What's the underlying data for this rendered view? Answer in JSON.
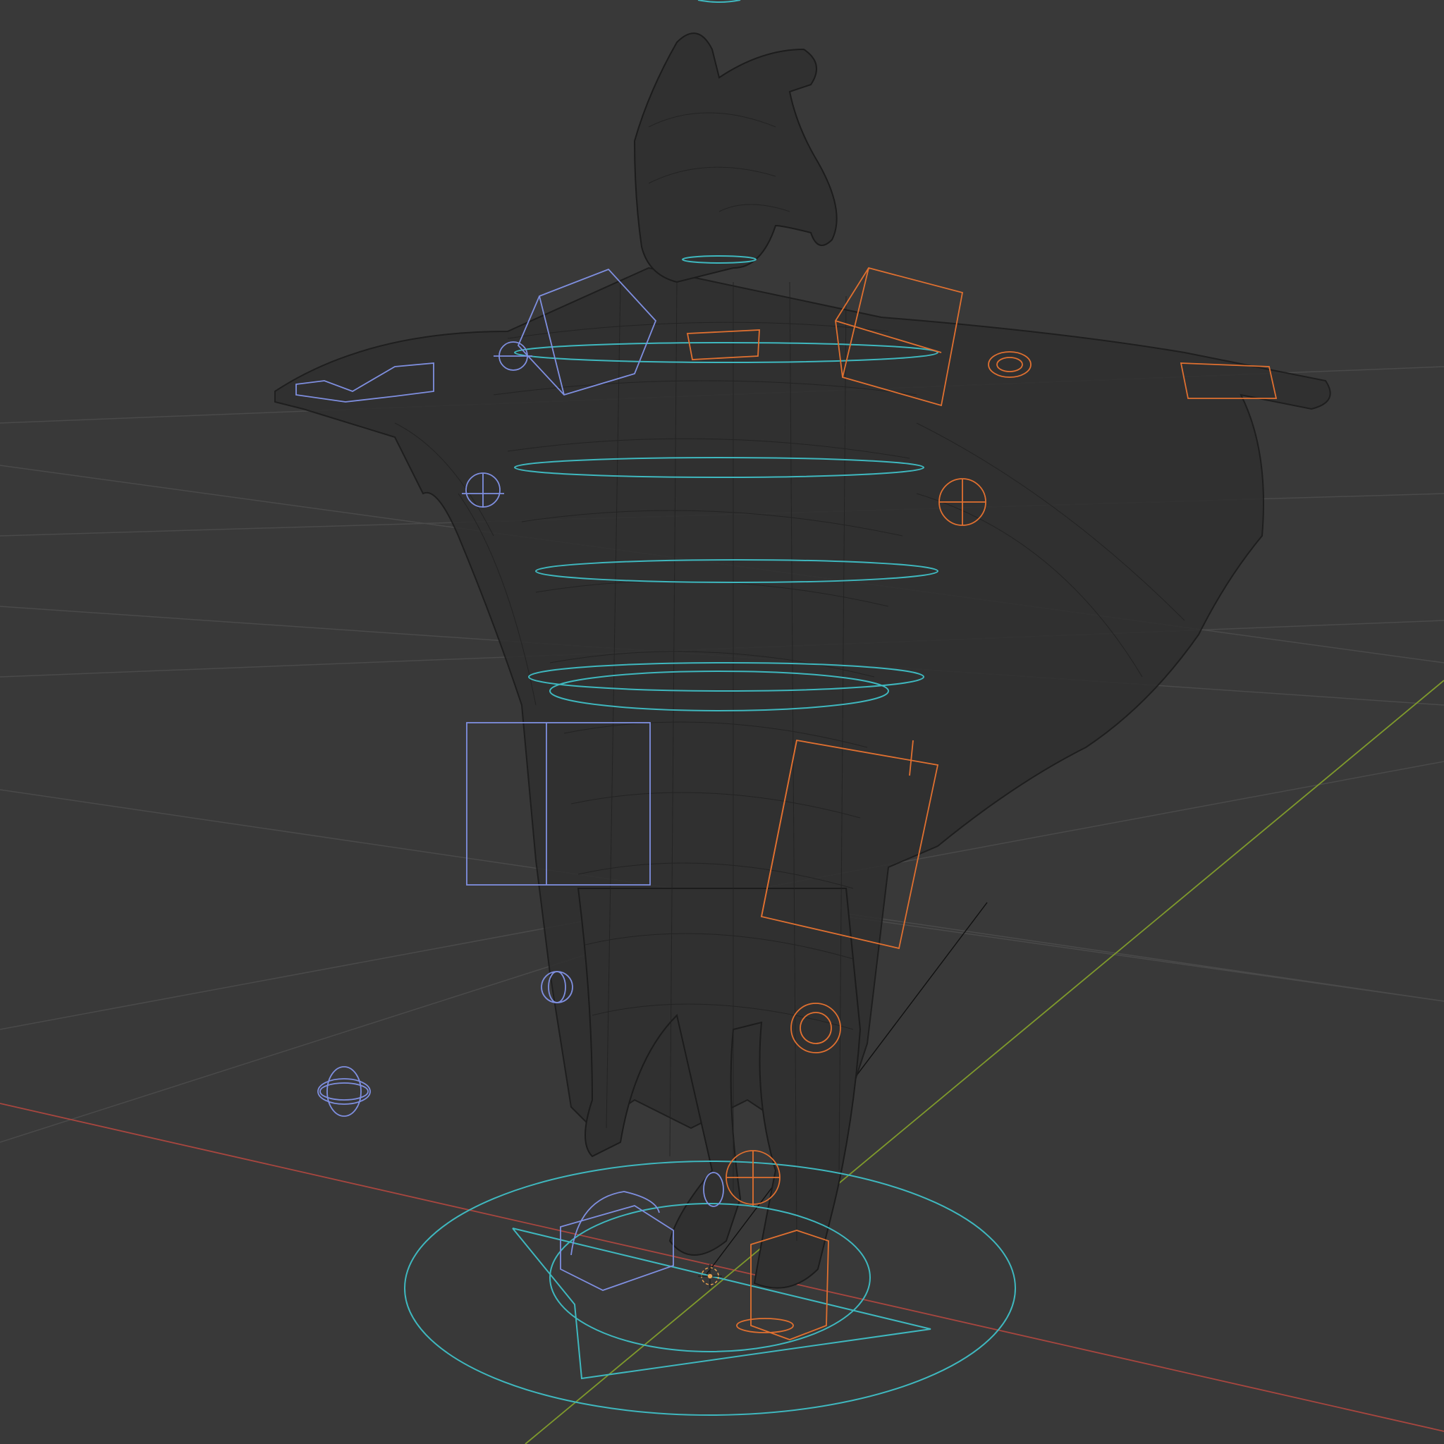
{
  "viewport": {
    "shading_mode": "wireframe",
    "background_color": "#393939",
    "colors": {
      "grid_line": "#4a4a4a",
      "x_axis": "#a8463f",
      "y_axis": "#7f9a2c",
      "mesh_wire": "#1c1c1c",
      "rig_cyan": "#3fb8bf",
      "rig_left": "#7f8fe0",
      "rig_right": "#e07030",
      "cursor_3d": "#e8a050"
    }
  },
  "scene": {
    "object": "character-mesh",
    "rig_controls": [
      "root-circle",
      "torso-rings",
      "hand-controls",
      "ik-pole-targets",
      "foot-controls"
    ]
  }
}
